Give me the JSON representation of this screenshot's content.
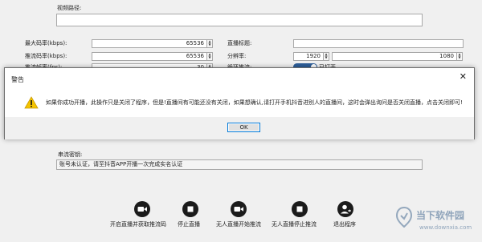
{
  "form": {
    "video_path_label": "视频路径:",
    "video_path_value": "",
    "max_bitrate_label": "最大码率(kbps):",
    "max_bitrate_value": "65536",
    "push_bitrate_label": "推流码率(kbps):",
    "push_bitrate_value": "65536",
    "push_fps_label": "推流帧率(fps):",
    "push_fps_value": "30",
    "live_title_label": "直播标题:",
    "live_title_value": "",
    "resolution_label": "分辨率:",
    "resolution_width": "1920",
    "resolution_height": "1080",
    "loop_push_label": "循环推流:",
    "loop_push_state": "已打开",
    "stream_key_label": "串流密钥:",
    "stream_key_value": "账号未认证，请至抖音APP开播一次完成实名认证"
  },
  "dialog": {
    "title": "警告",
    "message": "如果你成功开播，此操作只是关闭了程序，但是!直播间有可能还没有关闭，如果想确认,请打开手机抖音进别人的直播间，这时会弹出询问是否关闭直播，点击关闭即可!",
    "ok_label": "OK",
    "close_glyph": "✕"
  },
  "toolbar": {
    "items": [
      {
        "label": "开启直播并获取推流码",
        "icon": "camera-icon"
      },
      {
        "label": "停止直播",
        "icon": "stop-icon"
      },
      {
        "label": "无人直播开始推流",
        "icon": "camera-icon"
      },
      {
        "label": "无人直播停止推流",
        "icon": "stop-icon"
      },
      {
        "label": "退出程序",
        "icon": "user-exit-icon"
      }
    ]
  },
  "watermark": {
    "title": "当下软件园",
    "url": "www.downxia.com"
  },
  "colors": {
    "accent": "#0078d7",
    "toggle_on": "#2e5f9a",
    "warning": "#f5c400"
  }
}
